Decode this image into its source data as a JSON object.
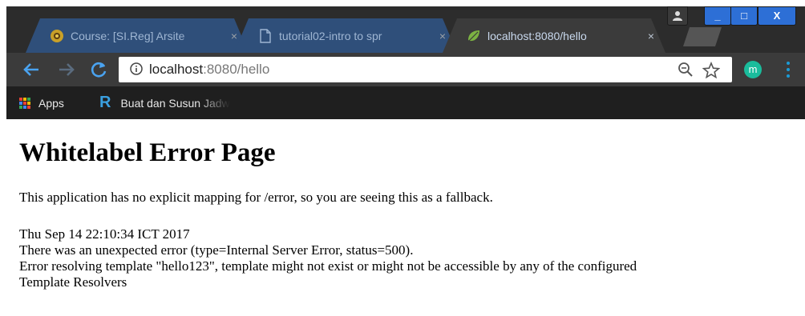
{
  "browser": {
    "tabs": [
      {
        "title": "Course: [SI.Reg] Arsite",
        "active": false,
        "icon": "course-favicon"
      },
      {
        "title": "tutorial02-intro to spr",
        "active": false,
        "icon": "document-favicon"
      },
      {
        "title": "localhost:8080/hello",
        "active": true,
        "icon": "spring-leaf-favicon"
      }
    ],
    "tab_close_glyph": "×",
    "window_controls": {
      "minimize": "_",
      "maximize": "□",
      "close": "X"
    },
    "address_bar": {
      "host": "localhost",
      "path": ":8080/hello",
      "icons": [
        "info-icon",
        "zoom-icon",
        "star-icon"
      ]
    },
    "profile_initial": "m",
    "bookmarks": [
      {
        "label": "Apps",
        "icon": "apps-grid-icon"
      },
      {
        "label": "Buat dan Susun Jadw",
        "icon": "r-logo-icon"
      }
    ],
    "colors": {
      "titlebar": "#2c2c2c",
      "toolbar": "#3b3b3b",
      "bookmarks_bar": "#1f1f1f",
      "window_controls": "#2d6fd6",
      "profile": "#1abc9c",
      "accent": "#1a9bd7"
    }
  },
  "page": {
    "heading": "Whitelabel Error Page",
    "message": "This application has no explicit mapping for /error, so you are seeing this as a fallback.",
    "timestamp": "Thu Sep 14 22:10:34 ICT 2017",
    "error_line": "There was an unexpected error (type=Internal Server Error, status=500).",
    "detail_line1": "Error resolving template \"hello123\", template might not exist or might not be accessible by any of the configured",
    "detail_line2": "Template Resolvers"
  }
}
